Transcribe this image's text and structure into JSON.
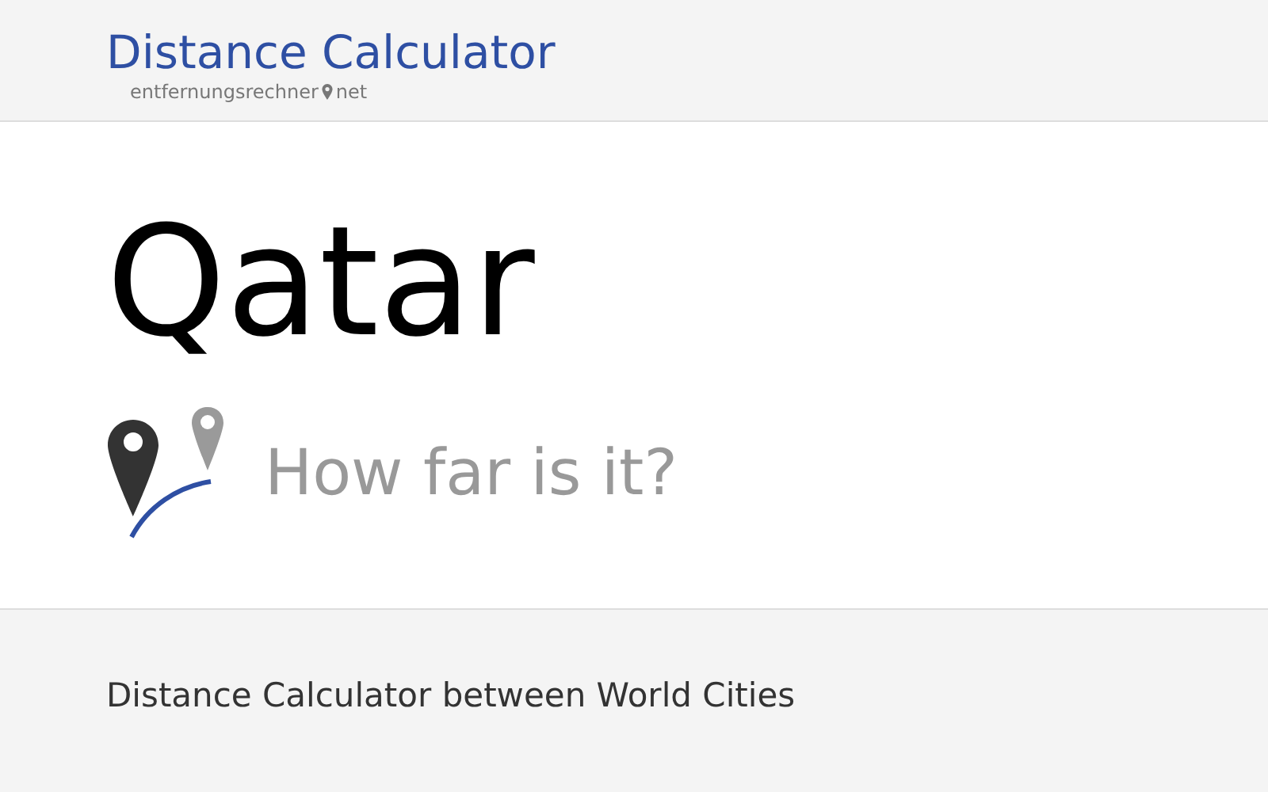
{
  "header": {
    "title": "Distance Calculator",
    "subtitle_left": "entfernungsrechner",
    "subtitle_right": "net"
  },
  "hero": {
    "heading": "Qatar",
    "tagline": "How far is it?"
  },
  "footer": {
    "text": "Distance Calculator between World Cities"
  }
}
